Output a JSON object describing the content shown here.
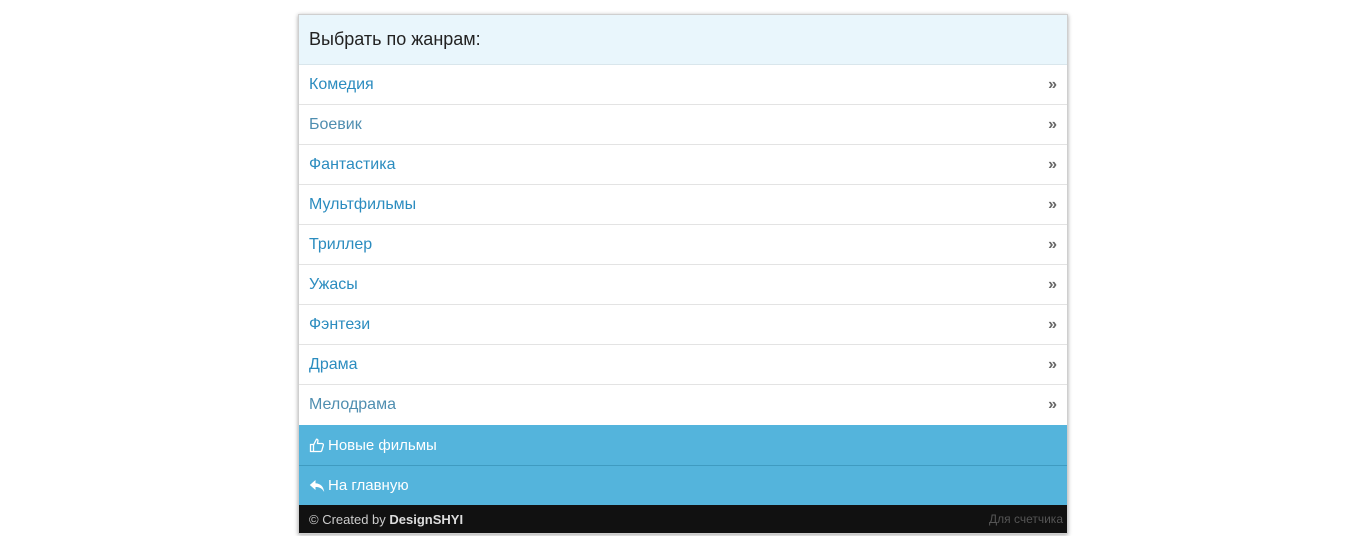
{
  "header": {
    "title": "Выбрать по жанрам:"
  },
  "genres": [
    {
      "label": "Комедия",
      "arrow": "»"
    },
    {
      "label": "Боевик",
      "arrow": "»"
    },
    {
      "label": "Фантастика",
      "arrow": "»"
    },
    {
      "label": "Мультфильмы",
      "arrow": "»"
    },
    {
      "label": "Триллер",
      "arrow": "»"
    },
    {
      "label": "Ужасы",
      "arrow": "»"
    },
    {
      "label": "Фэнтези",
      "arrow": "»"
    },
    {
      "label": "Драма",
      "arrow": "»"
    },
    {
      "label": "Мелодрама",
      "arrow": "»"
    }
  ],
  "actions": {
    "new_films": {
      "label": "Новые фильмы",
      "icon": "thumbs-up-icon"
    },
    "home": {
      "label": "На главную",
      "icon": "reply-icon"
    }
  },
  "footer": {
    "copyright": "© Created by ",
    "brand": "DesignSHYI",
    "counter": "Для счетчика"
  },
  "colors": {
    "header_bg": "#e9f6fc",
    "link": "#2b8cbf",
    "action_bg": "#54b4dc",
    "footer_bg": "#111111"
  }
}
